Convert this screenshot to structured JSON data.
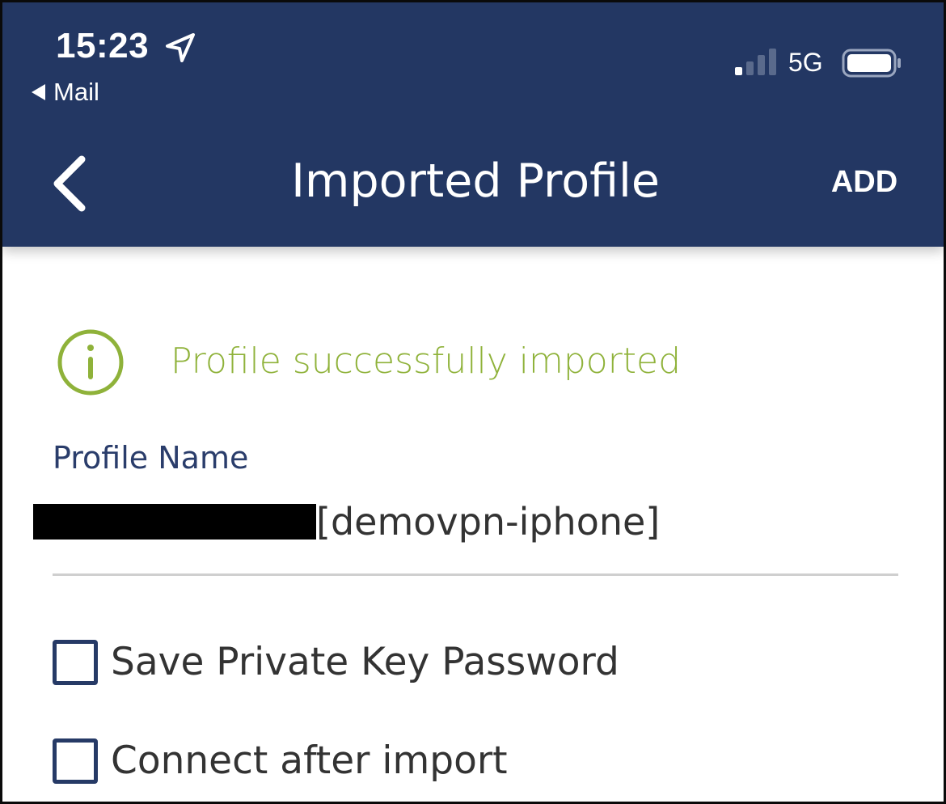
{
  "status_bar": {
    "time": "15:23",
    "back_app_label": "Mail",
    "network": "5G",
    "signal_bars_active": 1,
    "signal_bars_total": 4
  },
  "nav": {
    "title": "Imported Profile",
    "action_label": "ADD"
  },
  "notice": {
    "text": "Profile successfully imported",
    "color": "#8fb23a"
  },
  "form": {
    "profile_name_label": "Profile Name",
    "profile_name_value": "[demovpn-iphone]",
    "options": [
      {
        "label": "Save Private Key Password",
        "checked": false
      },
      {
        "label": "Connect after import",
        "checked": false
      }
    ]
  },
  "colors": {
    "header_bg": "#233763",
    "label_blue": "#2a3d6b",
    "checkbox_border": "#263a66"
  }
}
